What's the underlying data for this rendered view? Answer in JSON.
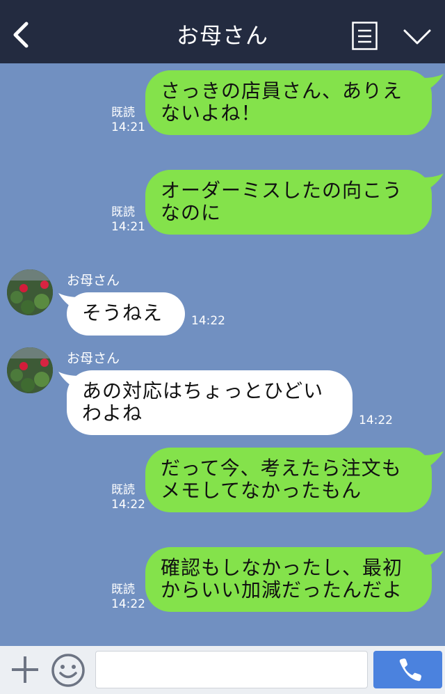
{
  "header": {
    "title": "お母さん",
    "back_icon": "chevron-left-icon",
    "menu_icon": "list-icon",
    "collapse_icon": "chevron-down-icon"
  },
  "messages": [
    {
      "side": "right",
      "lines": [
        "さっきの店員さん、ありえ",
        "ないよね！"
      ],
      "read": "既読",
      "time": "14:21"
    },
    {
      "side": "right",
      "lines": [
        "オーダーミスしたの向こう",
        "なのに"
      ],
      "read": "既読",
      "time": "14:21"
    },
    {
      "side": "left",
      "sender": "お母さん",
      "lines": [
        "そうねえ"
      ],
      "time": "14:22"
    },
    {
      "side": "left",
      "sender": "お母さん",
      "lines": [
        "あの対応はちょっとひどい",
        "わよね"
      ],
      "time": "14:22"
    },
    {
      "side": "right",
      "lines": [
        "だって今、考えたら注文も",
        "メモしてなかったもん"
      ],
      "read": "既読",
      "time": "14:22"
    },
    {
      "side": "right",
      "lines": [
        "確認もしなかったし、最初",
        "からいい加減だったんだよ"
      ],
      "read": "既読",
      "time": "14:22"
    }
  ],
  "input": {
    "placeholder": "",
    "plus_icon": "plus-icon",
    "emoji_icon": "smiley-icon",
    "call_icon": "phone-icon"
  },
  "colors": {
    "header_bg": "#232b40",
    "chat_bg": "#7190c1",
    "my_bubble": "#84e24b",
    "their_bubble": "#ffffff",
    "call_button": "#4b82de"
  }
}
